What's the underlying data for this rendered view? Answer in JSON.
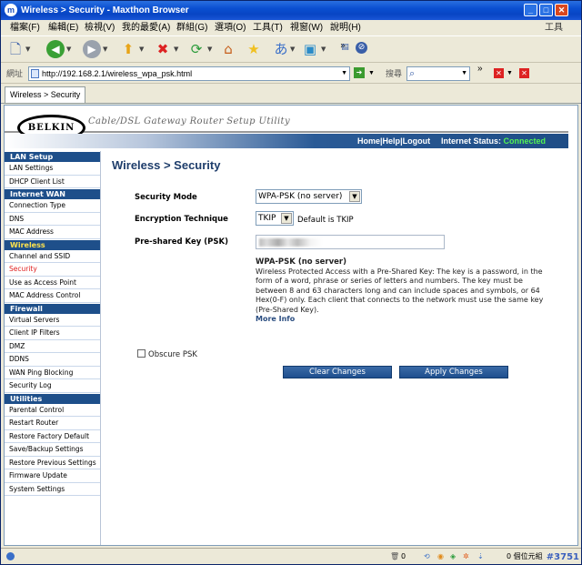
{
  "window": {
    "title": "Wireless > Security - Maxthon Browser",
    "min": "_",
    "max": "□",
    "close": "✕"
  },
  "menu": {
    "items": [
      "檔案(F)",
      "編輯(E)",
      "檢視(V)",
      "我的最愛(A)",
      "群組(G)",
      "選項(O)",
      "工具(T)",
      "視窗(W)",
      "說明(H)"
    ],
    "right": "工具"
  },
  "address": {
    "label": "網址",
    "url": "http://192.168.2.1/wireless_wpa_psk.html",
    "search_label": "搜尋"
  },
  "tabs": [
    {
      "label": "Wireless > Security"
    }
  ],
  "header": {
    "logo": "BELKIN",
    "tagline": "Cable/DSL Gateway Router Setup Utility",
    "home": "Home",
    "help": "Help",
    "logout": "Logout",
    "sep": "|",
    "status_label": "Internet Status:",
    "status_value": "Connected"
  },
  "sidebar": [
    {
      "section": "LAN Setup",
      "items": [
        "LAN Settings",
        "DHCP Client List"
      ]
    },
    {
      "section": "Internet WAN",
      "items": [
        "Connection Type",
        "DNS",
        "MAC Address"
      ]
    },
    {
      "section": "Wireless",
      "items": [
        "Channel and SSID",
        "Security",
        "Use as Access Point",
        "MAC Address Control"
      ]
    },
    {
      "section": "Firewall",
      "items": [
        "Virtual Servers",
        "Client IP Filters",
        "DMZ",
        "DDNS",
        "WAN Ping Blocking",
        "Security Log"
      ]
    },
    {
      "section": "Utilities",
      "items": [
        "Parental Control",
        "Restart Router",
        "Restore Factory Default",
        "Save/Backup Settings",
        "Restore Previous Settings",
        "Firmware Update",
        "System Settings"
      ]
    }
  ],
  "main": {
    "title": "Wireless > Security",
    "security_mode_label": "Security Mode",
    "security_mode_value": "WPA-PSK (no server)",
    "encryption_label": "Encryption Technique",
    "encryption_value": "TKIP",
    "encryption_default": "Default is TKIP",
    "psk_label": "Pre-shared Key (PSK)",
    "help_title": "WPA-PSK (no server)",
    "help_text": "Wireless Protected Access with a Pre-Shared Key: The key is a password, in the form of a word, phrase or series of letters and numbers. The key must be between 8 and 63 characters long and can include spaces and symbols, or 64 Hex(0-F) only. Each client that connects to the network must use the same key (Pre-Shared Key).",
    "more_info": "More Info",
    "obscure_label": "Obscure PSK",
    "clear_button": "Clear Changes",
    "apply_button": "Apply Changes"
  },
  "statusbar": {
    "count": "0",
    "right": "0 個位元組"
  },
  "watermark": "#3751"
}
